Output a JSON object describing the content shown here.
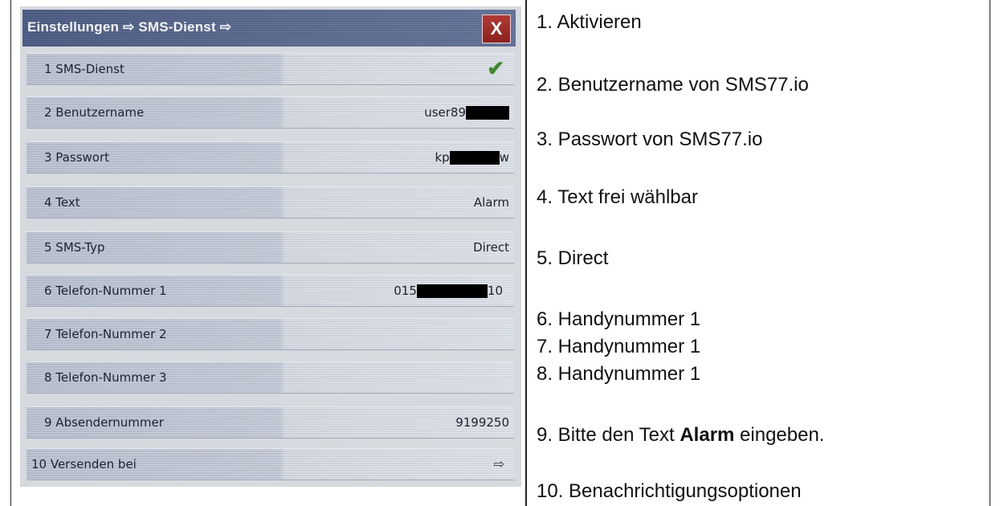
{
  "device": {
    "title": "Einstellungen ⇨ SMS-Dienst ⇨",
    "close_label": "X",
    "rows": [
      {
        "label": "1 SMS-Dienst",
        "value": "",
        "icon": "checkmark-icon"
      },
      {
        "label": "2 Benutzername",
        "value": "user89",
        "redacted": true
      },
      {
        "label": "3 Passwort",
        "value_prefix": "kp",
        "value_suffix": "w",
        "redacted": true
      },
      {
        "label": "4 Text",
        "value": "Alarm"
      },
      {
        "label": "5 SMS-Typ",
        "value": "Direct"
      },
      {
        "label": "6 Telefon-Nummer 1",
        "value_prefix": "015",
        "value_suffix": "10",
        "redacted": true
      },
      {
        "label": "7 Telefon-Nummer 2",
        "value": ""
      },
      {
        "label": "8 Telefon-Nummer 3",
        "value": ""
      },
      {
        "label": "9 Absendernummer",
        "value": "9199250"
      },
      {
        "label": "10 Versenden bei",
        "value": "⇨",
        "icon": "arrow-right-icon"
      }
    ]
  },
  "notes": {
    "n1": "1. Aktivieren",
    "n2": "2. Benutzername von SMS77.io",
    "n3": "3. Passwort von SMS77.io",
    "n4": "4. Text frei wählbar",
    "n5": "5. Direct",
    "n6": "6. Handynummer 1",
    "n7": "7. Handynummer 1",
    "n8": "8. Handynummer 1",
    "n9_prefix": "9. Bitte den Text ",
    "n9_bold": "Alarm",
    "n9_suffix": " eingeben.",
    "n10": "10. Benachrichtigungsoptionen"
  },
  "colors": {
    "titlebar": "#5e6c92",
    "close_button": "#a0302c",
    "checkmark": "#3f8a2c"
  }
}
